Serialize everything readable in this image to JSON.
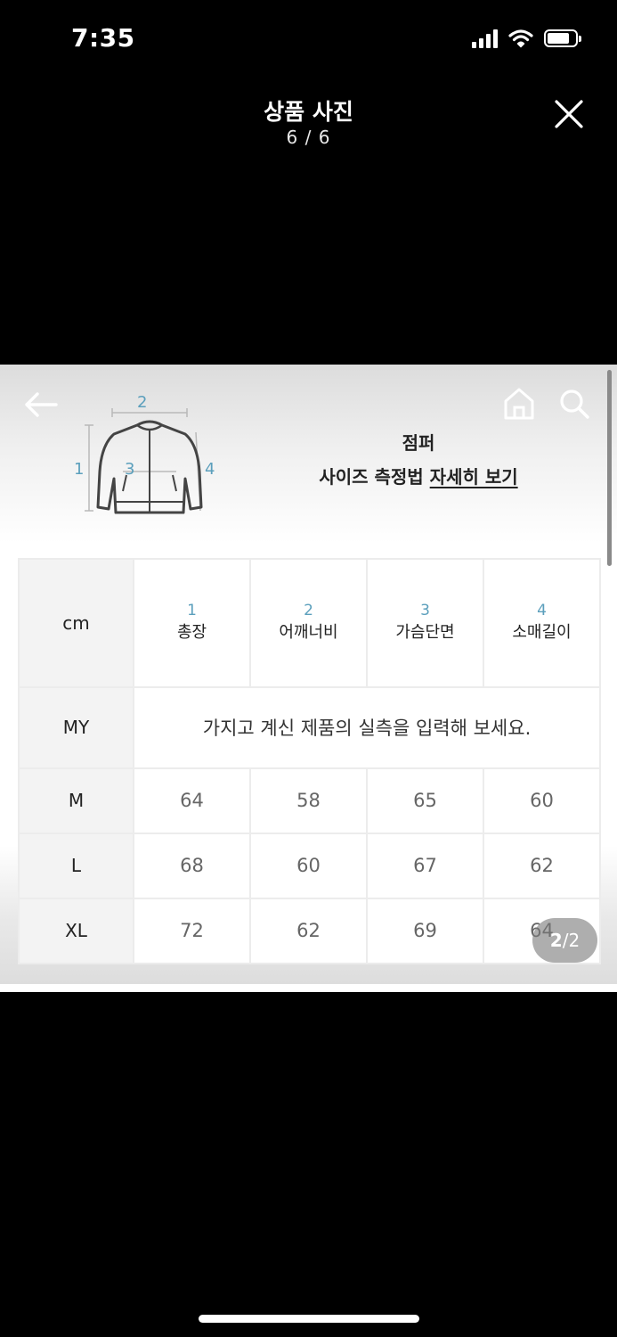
{
  "status_bar": {
    "time": "7:35"
  },
  "viewer": {
    "title": "상품 사진",
    "counter": "6 / 6"
  },
  "photo": {
    "diagram_labels": [
      "1",
      "2",
      "3",
      "4"
    ],
    "heading": "점퍼",
    "subheading_prefix": "사이즈 측정법 ",
    "subheading_link": "자세히 보기",
    "table": {
      "unit": "cm",
      "columns": [
        {
          "num": "1",
          "name": "총장"
        },
        {
          "num": "2",
          "name": "어깨너비"
        },
        {
          "num": "3",
          "name": "가슴단면"
        },
        {
          "num": "4",
          "name": "소매길이"
        }
      ],
      "my_label": "MY",
      "my_placeholder": "가지고 계신 제품의 실측을 입력해 보세요.",
      "rows": [
        {
          "size": "M",
          "values": [
            "64",
            "58",
            "65",
            "60"
          ]
        },
        {
          "size": "L",
          "values": [
            "68",
            "60",
            "67",
            "62"
          ]
        },
        {
          "size": "XL",
          "values": [
            "72",
            "62",
            "69",
            "64"
          ]
        }
      ]
    },
    "page_badge": {
      "current": "2",
      "total": "2"
    }
  }
}
